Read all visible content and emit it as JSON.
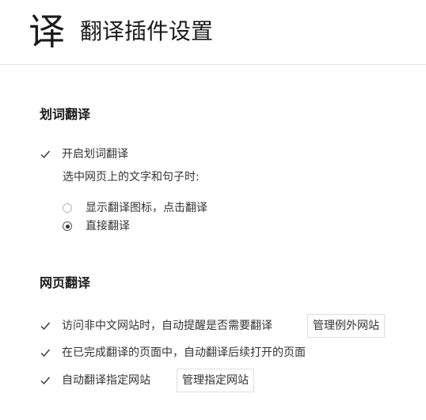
{
  "header": {
    "logo": "译",
    "title": "翻译插件设置"
  },
  "word_translate": {
    "title": "划词翻译",
    "enable_label": "开启划词翻译",
    "enable_checked": true,
    "hint": "选中网页上的文字和句子时:",
    "options": [
      {
        "label": "显示翻译图标，点击翻译",
        "selected": false
      },
      {
        "label": "直接翻译",
        "selected": true
      }
    ]
  },
  "page_translate": {
    "title": "网页翻译",
    "items": [
      {
        "label": "访问非中文网站时，自动提醒是否需要翻译",
        "checked": true,
        "button": "管理例外网站"
      },
      {
        "label": "在已完成翻译的页面中，自动翻译后续打开的页面",
        "checked": true
      },
      {
        "label": "自动翻译指定网站",
        "checked": true,
        "button": "管理指定网站"
      }
    ]
  }
}
